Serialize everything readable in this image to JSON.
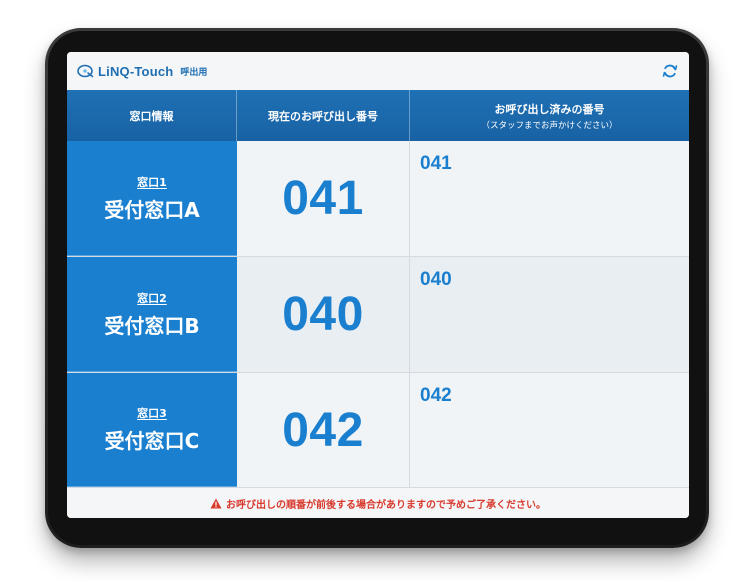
{
  "app": {
    "logo_text": "LiNQ-Touch",
    "logo_sub": "呼出用",
    "brand_color": "#1f6fb2",
    "accent_color": "#1a7fcf",
    "refresh_icon": "refresh-icon"
  },
  "table": {
    "headers": {
      "window_info": "窓口情報",
      "current_call": "現在のお呼び出し番号",
      "called_numbers": "お呼び出し済みの番号",
      "called_numbers_note": "（スタッフまでお声かけください）"
    },
    "rows": [
      {
        "window_no": "窓口1",
        "window_name": "受付窓口A",
        "current": "041",
        "called": "041"
      },
      {
        "window_no": "窓口2",
        "window_name": "受付窓口B",
        "current": "040",
        "called": "040"
      },
      {
        "window_no": "窓口3",
        "window_name": "受付窓口C",
        "current": "042",
        "called": "042"
      }
    ]
  },
  "footer": {
    "notice": "お呼び出しの順番が前後する場合がありますので予めご了承ください。",
    "warning_icon": "warning-icon",
    "warning_color": "#d83a2e"
  }
}
